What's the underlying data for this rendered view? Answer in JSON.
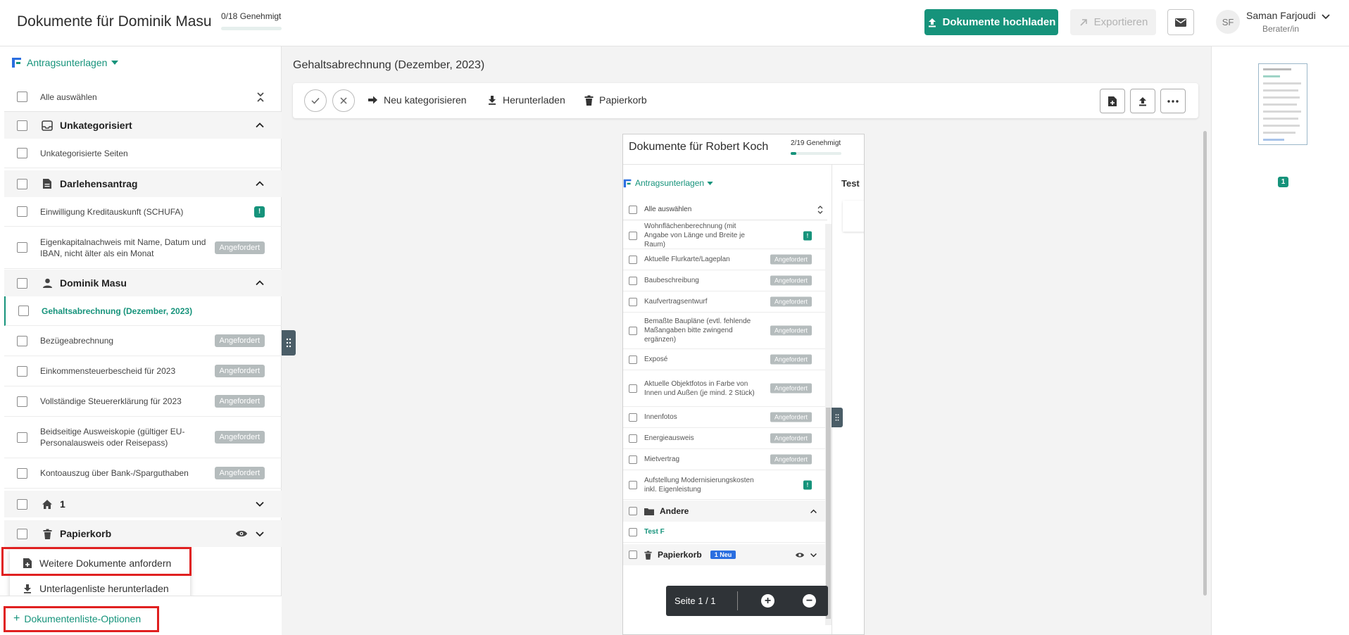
{
  "header": {
    "title": "Dokumente für Dominik Masu",
    "approved_text": "0/18 Genehmigt",
    "upload_label": "Dokumente hochladen",
    "export_label": "Exportieren",
    "user_initials": "SF",
    "user_name": "Saman Farjoudi",
    "user_role": "Berater/in"
  },
  "sidebar": {
    "section_label": "Antragsunterlagen",
    "select_all_label": "Alle auswählen",
    "rows": [
      {
        "type": "group",
        "label": "Unkategorisiert",
        "icon": "inbox-icon",
        "expanded": true
      },
      {
        "type": "item",
        "label": "Unkategorisierte Seiten"
      },
      {
        "type": "group",
        "label": "Darlehensantrag",
        "icon": "document-icon",
        "expanded": true
      },
      {
        "type": "item",
        "label": "Einwilligung Kreditauskunft (SCHUFA)",
        "badge": "warn",
        "warn_text": "!"
      },
      {
        "type": "item",
        "label": "Eigenkapitalnachweis mit Name, Datum und IBAN, nicht älter als ein Monat",
        "badge": "Angefordert"
      },
      {
        "type": "group",
        "label": "Dominik Masu",
        "icon": "person-icon",
        "expanded": true
      },
      {
        "type": "item",
        "label": "Gehaltsabrechnung (Dezember, 2023)",
        "active": true
      },
      {
        "type": "item",
        "label": "Bezügeabrechnung",
        "badge": "Angefordert"
      },
      {
        "type": "item",
        "label": "Einkommensteuerbescheid für 2023",
        "badge": "Angefordert"
      },
      {
        "type": "item",
        "label": "Vollständige Steuererklärung für 2023",
        "badge": "Angefordert"
      },
      {
        "type": "item",
        "label": "Beidseitige Ausweiskopie (gültiger EU-Personalausweis oder Reisepass)",
        "badge": "Angefordert"
      },
      {
        "type": "item",
        "label": "Kontoauszug über Bank-/Sparguthaben",
        "badge": "Angefordert"
      },
      {
        "type": "group",
        "label": "1",
        "icon": "home-icon",
        "expanded": false
      },
      {
        "type": "group",
        "label": "Papierkorb",
        "icon": "trash-icon",
        "expanded": false,
        "eye": true
      }
    ],
    "popover": {
      "request_more": "Weitere Dokumente anfordern",
      "download_list": "Unterlagenliste herunterladen"
    },
    "footer_label": "Dokumentenliste-Optionen"
  },
  "main": {
    "title": "Gehaltsabrechnung (Dezember, 2023)",
    "toolbar": {
      "recategorize": "Neu kategorisieren",
      "download": "Herunterladen",
      "trash": "Papierkorb"
    }
  },
  "document": {
    "title": "Dokumente für Robert Koch",
    "approved_text": "2/19 Genehmigt",
    "approved_fraction": 0.105,
    "section_label": "Antragsunterlagen",
    "select_all_label": "Alle auswählen",
    "side_title": "Test",
    "rows": [
      {
        "label": "Wohnflächenberechnung (mit Angabe von Länge und Breite je Raum)",
        "badge": "warn",
        "warn_text": "!"
      },
      {
        "label": "Aktuelle Flurkarte/Lageplan",
        "badge": "Angefordert"
      },
      {
        "label": "Baubeschreibung",
        "badge": "Angefordert"
      },
      {
        "label": "Kaufvertragsentwurf",
        "badge": "Angefordert"
      },
      {
        "label": "Bemaßte Baupläne (evtl. fehlende Maßangaben bitte zwingend ergänzen)",
        "badge": "Angefordert"
      },
      {
        "label": "Exposé",
        "badge": "Angefordert"
      },
      {
        "label": "Aktuelle Objektfotos in Farbe von Innen und Außen (je mind. 2 Stück)",
        "badge": "Angefordert"
      },
      {
        "label": "Innenfotos",
        "badge": "Angefordert"
      },
      {
        "label": "Energieausweis",
        "badge": "Angefordert"
      },
      {
        "label": "Mietvertrag",
        "badge": "Angefordert"
      },
      {
        "label": "Aufstellung Modernisierungskosten inkl. Eigenleistung",
        "badge": "warn",
        "warn_text": "!"
      }
    ],
    "group_other": "Andere",
    "partial_item": "Test F",
    "trash_label": "Papierkorb",
    "new_badge": "1 Neu"
  },
  "pager": {
    "page_text": "Seite 1 / 1",
    "zoom_in": "+",
    "zoom_out": "−"
  },
  "thumbnails": {
    "page_badge": "1"
  },
  "colors": {
    "accent": "#16937b",
    "highlight": "#e02020"
  }
}
